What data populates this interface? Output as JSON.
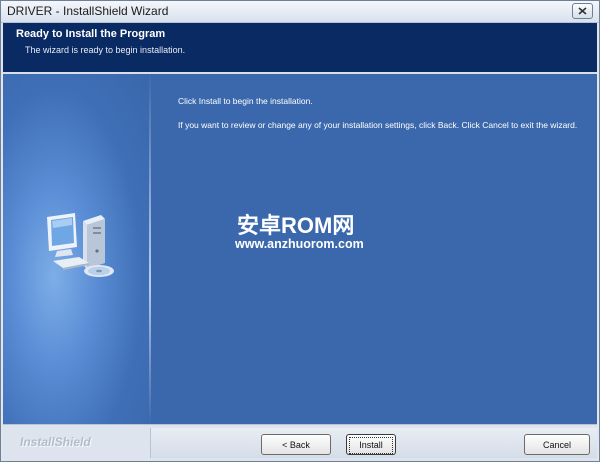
{
  "window": {
    "title": "DRIVER - InstallShield Wizard"
  },
  "header": {
    "title": "Ready to Install the Program",
    "subtitle": "The wizard is ready to begin installation."
  },
  "body": {
    "line1": "Click Install to begin the installation.",
    "line2": "If you want to review or change any of your installation settings, click Back. Click Cancel to exit the wizard."
  },
  "watermark": {
    "text": "安卓ROM网",
    "url": "www.anzhuorom.com"
  },
  "footer": {
    "brand": "InstallShield",
    "buttons": {
      "back": "< Back",
      "install": "Install",
      "cancel": "Cancel"
    }
  },
  "icons": {
    "close": "close-icon",
    "computer": "computer-cd-icon"
  },
  "colors": {
    "header_bg": "#0a2a63",
    "content_bg": "#3b68ac",
    "footer_bg": "#dde4ed"
  }
}
